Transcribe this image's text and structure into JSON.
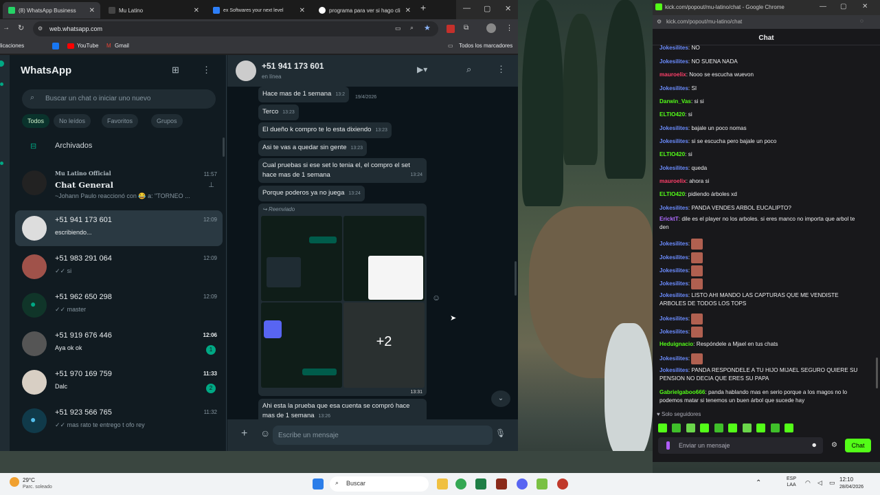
{
  "tabs": [
    {
      "title": "(8) WhatsApp Business",
      "color": "#25d366"
    },
    {
      "title": "Mu Latino",
      "color": "#333"
    },
    {
      "title": "ex Softwares your next level",
      "color": "#2d7ff9"
    },
    {
      "title": "programa para ver si hago cli",
      "color": "#fff"
    }
  ],
  "url": "web.whatsapp.com",
  "bookmarks": [
    "licaciones",
    "YouTube",
    "Gmail",
    "Todos los marcadores"
  ],
  "wa": {
    "title": "WhatsApp",
    "search_placeholder": "Buscar un chat o iniciar uno nuevo",
    "chips": [
      "Todos",
      "No leídos",
      "Favoritos",
      "Grupos"
    ],
    "archived": "Archivados",
    "chats": [
      {
        "group": "Mu Latino Official",
        "name": "Chat General",
        "msg": "~Johann Paulo reaccionó con 😂 a: \"TORNEO ...",
        "time": "11:57"
      },
      {
        "name": "+51 941 173 601",
        "msg": "escribiendo...",
        "time": "12:09"
      },
      {
        "name": "+51 983 291 064",
        "msg": "✓✓ si",
        "time": "12:09"
      },
      {
        "name": "+51 962 650 298",
        "msg": "✓✓ master",
        "time": "12:09"
      },
      {
        "name": "+51 919 676 446",
        "msg": "Aya ok ok",
        "time": "12:06",
        "unread": "1"
      },
      {
        "name": "+51 970 169 759",
        "msg": "Dalc",
        "time": "11:33",
        "unread": "2"
      },
      {
        "name": "+51 923 566 765",
        "msg": "✓✓ mas rato te entrego t ofo rey",
        "time": "11:32"
      }
    ],
    "contact": {
      "name": "+51 941 173 601",
      "status": "en línea"
    },
    "messages": [
      {
        "text": "Hace mas de 1 semana",
        "time": "13:2"
      },
      {
        "text": "Terco",
        "time": "13:23"
      },
      {
        "text": "El dueño k compro te lo esta dixiendo",
        "time": "13:23"
      },
      {
        "text": "Asi te vas a quedar sin gente",
        "time": "13:23"
      },
      {
        "text": "Cual pruebas si ese set lo tenia el, el compro el set hace mas de 1 semana",
        "time": "13:24"
      },
      {
        "text": "Porque poderos ya no juega",
        "time": "13:24"
      },
      {
        "text": "Ahi esta la prueba que esa cuenta se compró hace mas de 1 semana",
        "time": "13:26"
      }
    ],
    "date_chip": "19/4/2026",
    "forwarded": "Reenviado",
    "media_more": "+2",
    "media_time": "13:31",
    "composer_placeholder": "Escribe un mensaje"
  },
  "kick": {
    "window_title": "kick.com/popout/mu-latino/chat - Google Chrome",
    "url": "kick.com/popout/mu-latino/chat",
    "header": "Chat",
    "messages": [
      {
        "user": "Jokesilites",
        "color": "#6b8cff",
        "text": "NO"
      },
      {
        "user": "Jokesilites",
        "color": "#6b8cff",
        "text": "NO SUENA NADA"
      },
      {
        "user": "mauroelix",
        "color": "#ff3f6a",
        "text": "Nooo se escucha wuevon"
      },
      {
        "user": "Jokesilites",
        "color": "#6b8cff",
        "text": "SI"
      },
      {
        "user": "Darwin_Vas",
        "color": "#53fc18",
        "text": "si si"
      },
      {
        "user": "ELTIO420",
        "color": "#53fc18",
        "text": "si"
      },
      {
        "user": "Jokesilites",
        "color": "#6b8cff",
        "text": "bajale un poco nomas"
      },
      {
        "user": "Jokesilites",
        "color": "#6b8cff",
        "text": "si se escucha pero bajale un poco"
      },
      {
        "user": "ELTIO420",
        "color": "#53fc18",
        "text": "si"
      },
      {
        "user": "Jokesilites",
        "color": "#6b8cff",
        "text": "queda"
      },
      {
        "user": "mauroelix",
        "color": "#ff3f6a",
        "text": "ahora si"
      },
      {
        "user": "ELTIO420",
        "color": "#53fc18",
        "text": "pidiendo árboles xd"
      },
      {
        "user": "Jokesilites",
        "color": "#6b8cff",
        "text": "PANDA VENDES ARBOL EUCALIPTO?"
      },
      {
        "user": "EricktT",
        "color": "#b06bff",
        "text": "dile es el player no los arboles. si eres manco no importa que arbol te den"
      },
      {
        "user": "Jokesilites",
        "color": "#6b8cff",
        "text": "",
        "emote": true
      },
      {
        "user": "Jokesilites",
        "color": "#6b8cff",
        "text": "",
        "emote": true
      },
      {
        "user": "Jokesilites",
        "color": "#6b8cff",
        "text": "",
        "emote": true
      },
      {
        "user": "Jokesilites",
        "color": "#6b8cff",
        "text": "",
        "emote": true
      },
      {
        "user": "Jokesilites",
        "color": "#6b8cff",
        "text": "LISTO AHI MANDO LAS CAPTURAS QUE ME VENDISTE ARBOLES DE TODOS LOS TOPS"
      },
      {
        "user": "Jokesilites",
        "color": "#6b8cff",
        "text": "",
        "emote": true
      },
      {
        "user": "Jokesilites",
        "color": "#6b8cff",
        "text": "",
        "emote": true
      },
      {
        "user": "Heduignacio",
        "color": "#53fc18",
        "text": "Respóndele a Mjael en tus chats"
      },
      {
        "user": "Jokesilites",
        "color": "#6b8cff",
        "text": "",
        "emote": true
      },
      {
        "user": "Jokesilites",
        "color": "#6b8cff",
        "text": "PANDA RESPONDELE A TU HIJO MIJAEL SEGURO QUIERE SU PENSION NO DECIA QUE ERES SU PAPA"
      },
      {
        "user": "Gabrielgaboo666",
        "color": "#53fc18",
        "text": "panda hablando mas en serio porque a los magos no lo podemos matar si tenemos un buen árbol que sucede hay"
      }
    ],
    "followers_only": "Solo seguidores",
    "input_placeholder": "Enviar un mensaje",
    "send_label": "Chat"
  },
  "taskbar": {
    "weather_temp": "29°C",
    "weather_text": "Parc. soleado",
    "search": "Buscar",
    "lang": "ESP\nLAA",
    "time": "12:10",
    "date": "28/04/2026"
  }
}
